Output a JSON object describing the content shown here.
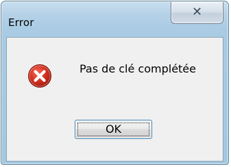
{
  "window": {
    "title": "Error",
    "close_icon": "close-icon"
  },
  "dialog": {
    "icon": "error-icon",
    "message": "Pas de clé complétée",
    "ok_label": "OK"
  },
  "colors": {
    "frame": "#a4c8e1",
    "client_background": "#f0f0f0",
    "error_red": "#cf2a1e",
    "focus_border": "#3c7fb1"
  }
}
